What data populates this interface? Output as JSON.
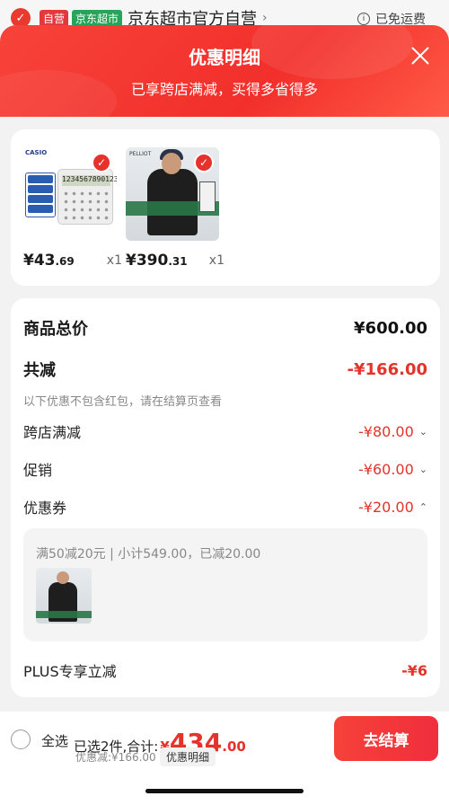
{
  "store_header": {
    "tag_self": "自营",
    "tag_jd": "京东超市",
    "store_name": "京东超市官方自营",
    "chevron": "›",
    "free_shipping": "已免运费"
  },
  "sheet": {
    "title": "优惠明细",
    "subtitle": "已享跨店满减，买得多省得多"
  },
  "products": [
    {
      "price_main": "¥43",
      "price_decimal": ".69",
      "quantity": "x1",
      "brand": "CASIO",
      "screen_text": "1234567890123",
      "icon": "calculator-product-image"
    },
    {
      "price_main": "¥390",
      "price_decimal": ".31",
      "quantity": "x1",
      "brand": "PELLIOT",
      "icon": "jacket-product-image"
    }
  ],
  "summary": {
    "total_label": "商品总价",
    "total_value": "¥600.00",
    "reduce_label": "共减",
    "reduce_value": "-¥166.00",
    "note": "以下优惠不包含红包，请在结算页查看",
    "items": [
      {
        "label": "跨店满减",
        "value": "-¥80.00",
        "chevron": "⌄"
      },
      {
        "label": "促销",
        "value": "-¥60.00",
        "chevron": "⌄"
      },
      {
        "label": "优惠券",
        "value": "-¥20.00",
        "chevron": "⌃"
      }
    ],
    "coupon_detail": "满50减20元 | 小计549.00，已减20.00",
    "plus_label": "PLUS专享立减",
    "plus_value": "-¥6"
  },
  "bottom_bar": {
    "select_all": "全选",
    "selected_text": "已选2件,合计:",
    "total_symbol": "¥",
    "total_int": "434",
    "total_dec": ".00",
    "discount_text": "优惠减:¥166.00",
    "detail_label": "优惠明细",
    "checkout_label": "去结算"
  },
  "colors": {
    "accent_red": "#e4332b",
    "header_red": "#f7433a",
    "green_tag": "#27a35a"
  }
}
